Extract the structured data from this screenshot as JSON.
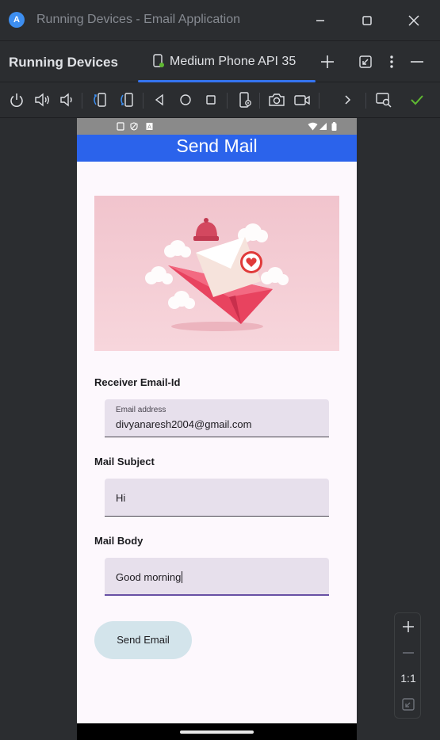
{
  "window": {
    "title": "Running Devices - Email Application",
    "logo_letter": "A"
  },
  "toolwindow": {
    "panel_title": "Running Devices",
    "device_tab_label": "Medium Phone API 35"
  },
  "zoom": {
    "ratio_label": "1:1"
  },
  "app": {
    "title": "Send Mail",
    "accent_color": "#2b63eb",
    "receiver": {
      "section_label": "Receiver Email-Id",
      "floating_label": "Email address",
      "value": "divyanaresh2004@gmail.com"
    },
    "subject": {
      "section_label": "Mail Subject",
      "value": "Hi"
    },
    "body": {
      "section_label": "Mail Body",
      "value": "Good morning"
    },
    "send_button_label": "Send Email"
  },
  "icons": {
    "titlebar": [
      "android-studio-logo-icon",
      "minimize-icon",
      "maximize-icon",
      "close-icon"
    ],
    "toolwindow": [
      "device-tab-icon",
      "add-device-icon",
      "restore-icon",
      "more-options-icon",
      "hide-panel-icon"
    ],
    "device_controls": [
      "power-icon",
      "volume-up-icon",
      "volume-down-icon",
      "rotate-left-icon",
      "rotate-right-icon",
      "back-icon",
      "home-icon",
      "overview-icon",
      "device-settings-icon",
      "screenshot-icon",
      "screen-record-icon",
      "expand-icon",
      "search-device-icon",
      "check-icon"
    ],
    "zoom": [
      "zoom-in-icon",
      "zoom-out-icon",
      "fit-screen-icon"
    ]
  }
}
